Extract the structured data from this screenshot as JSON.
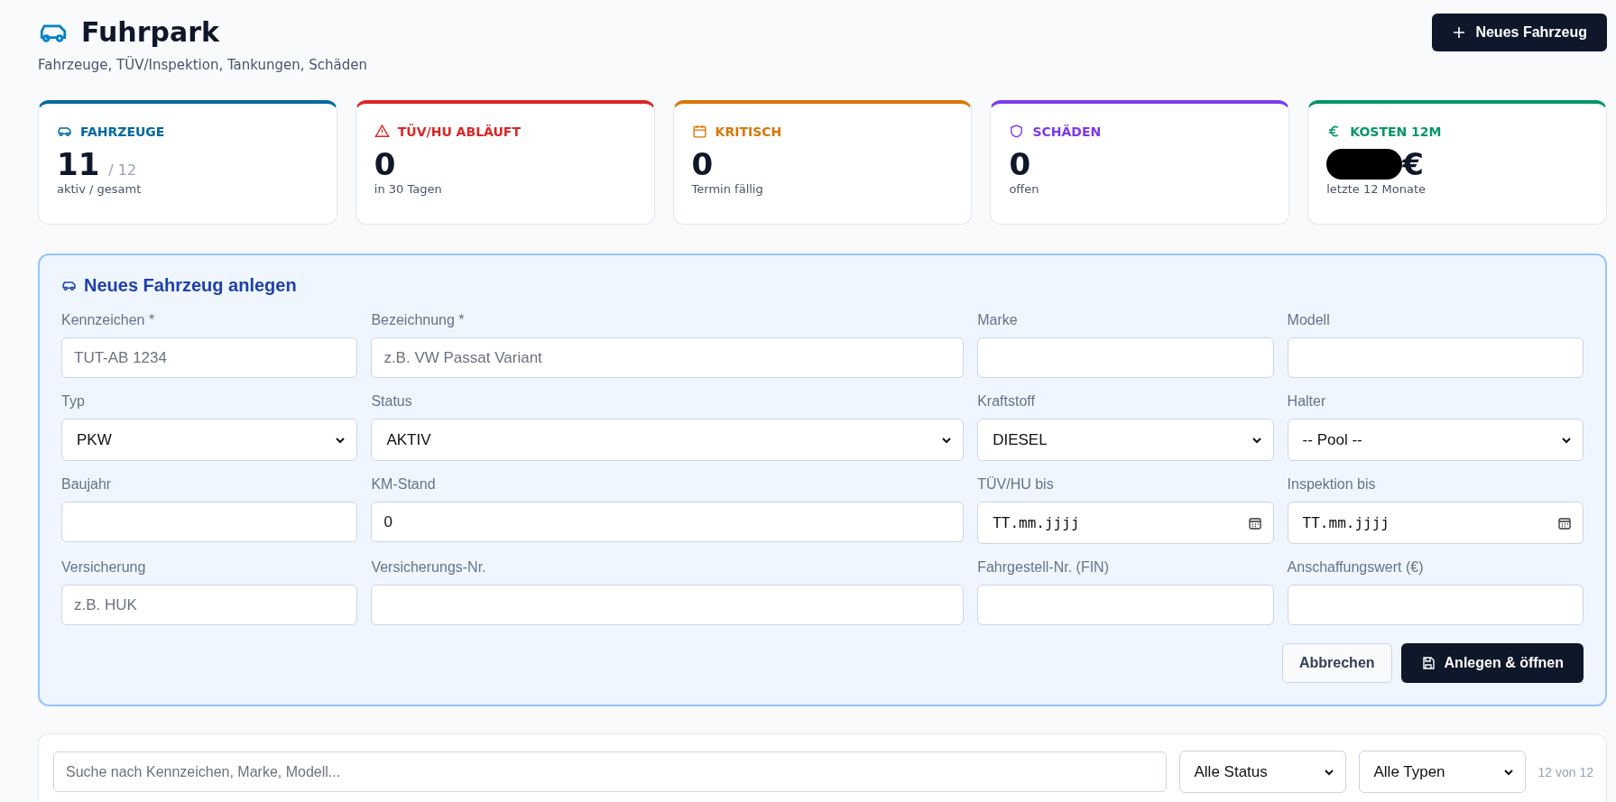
{
  "header": {
    "title": "Fuhrpark",
    "subtitle": "Fahrzeuge, TÜV/Inspektion, Tankungen, Schäden",
    "new_button": "Neues Fahrzeug"
  },
  "cards": [
    {
      "kind": "car",
      "label": "FAHRZEUGE",
      "color": "#0369a1",
      "value": "11",
      "secondary": "/ 12",
      "note": "aktiv / gesamt"
    },
    {
      "kind": "warning",
      "label": "TÜV/HU ABLÄUFT",
      "color": "#dc2626",
      "value": "0",
      "note": "in 30 Tagen"
    },
    {
      "kind": "calendar",
      "label": "KRITISCH",
      "color": "#d97706",
      "value": "0",
      "note": "Termin fällig"
    },
    {
      "kind": "shield",
      "label": "SCHÄDEN",
      "color": "#7c3aed",
      "value": "0",
      "note": "offen"
    },
    {
      "kind": "euro",
      "label": "KOSTEN 12M",
      "color": "#059669",
      "value": "€",
      "redacted": true,
      "note": "letzte 12 Monate"
    }
  ],
  "form": {
    "title": "Neues Fahrzeug anlegen",
    "fields": [
      {
        "kind": "input",
        "label": "Kennzeichen *",
        "placeholder": "TUT-AB 1234"
      },
      {
        "kind": "input",
        "label": "Bezeichnung *",
        "placeholder": "z.B. VW Passat Variant"
      },
      {
        "kind": "input",
        "label": "Marke"
      },
      {
        "kind": "input",
        "label": "Modell"
      },
      {
        "kind": "select",
        "label": "Typ",
        "value": "PKW"
      },
      {
        "kind": "select",
        "label": "Status",
        "value": "AKTIV"
      },
      {
        "kind": "select",
        "label": "Kraftstoff",
        "value": "DIESEL"
      },
      {
        "kind": "select",
        "label": "Halter",
        "value": "-- Pool --"
      },
      {
        "kind": "input",
        "label": "Baujahr"
      },
      {
        "kind": "input",
        "label": "KM-Stand",
        "value": "0"
      },
      {
        "kind": "date",
        "label": "TÜV/HU bis",
        "placeholder": "TT.mm.jjjj"
      },
      {
        "kind": "date",
        "label": "Inspektion bis",
        "placeholder": "TT.mm.jjjj"
      },
      {
        "kind": "input",
        "label": "Versicherung",
        "placeholder": "z.B. HUK"
      },
      {
        "kind": "input",
        "label": "Versicherungs-Nr."
      },
      {
        "kind": "input",
        "label": "Fahrgestell-Nr. (FIN)"
      },
      {
        "kind": "input",
        "label": "Anschaffungswert (€)"
      }
    ],
    "cancel_button": "Abbrechen",
    "submit_button": "Anlegen & öffnen"
  },
  "filter": {
    "search_placeholder": "Suche nach Kennzeichen, Marke, Modell...",
    "status_select": "Alle Status",
    "type_select": "Alle Typen",
    "count": "12 von 12"
  }
}
